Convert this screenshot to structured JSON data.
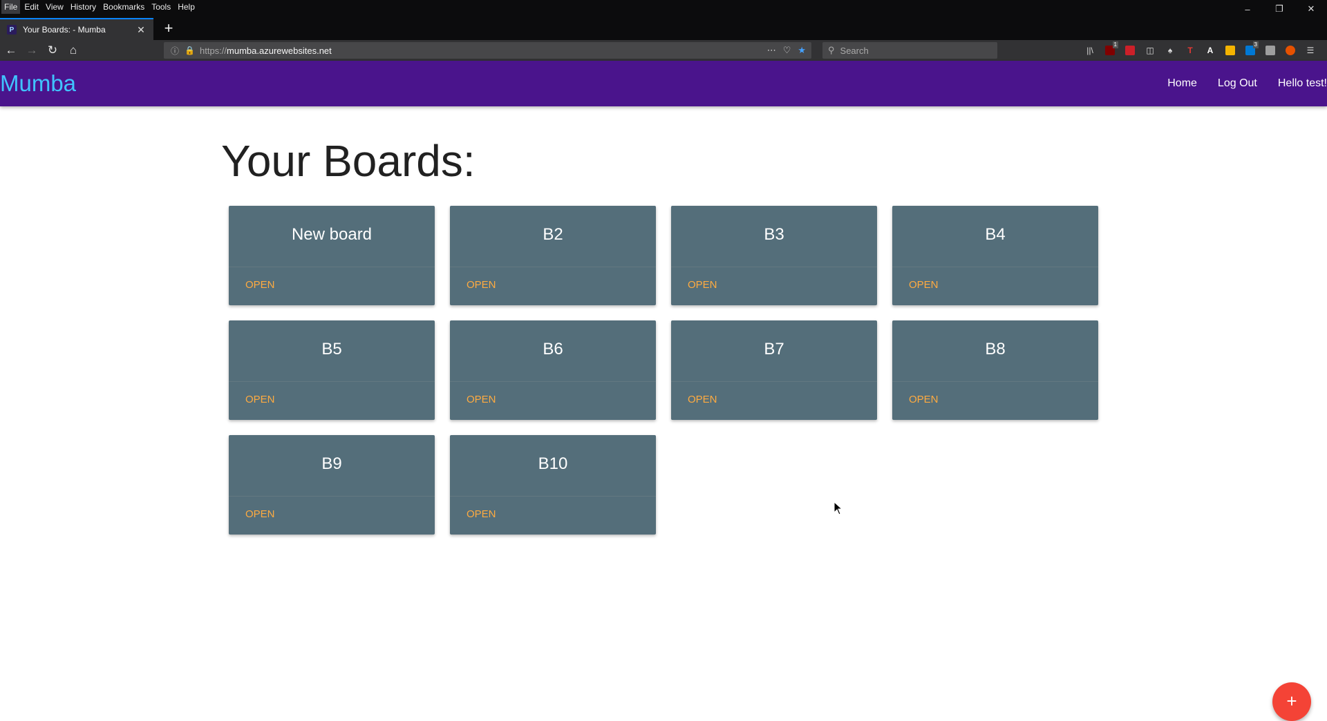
{
  "browser": {
    "menu": [
      "File",
      "Edit",
      "View",
      "History",
      "Bookmarks",
      "Tools",
      "Help"
    ],
    "tab": {
      "title": "Your Boards: - Mumba",
      "favicon_letter": "P"
    },
    "url": {
      "protocol": "https://",
      "host": "mumba.azurewebsites.net"
    },
    "search_placeholder": "Search"
  },
  "app": {
    "brand": "Mumba",
    "nav_links": [
      "Home",
      "Log Out",
      "Hello test!"
    ],
    "page_title": "Your Boards:",
    "open_label": "OPEN",
    "boards": [
      {
        "title": "New board"
      },
      {
        "title": "B2"
      },
      {
        "title": "B3"
      },
      {
        "title": "B4"
      },
      {
        "title": "B5"
      },
      {
        "title": "B6"
      },
      {
        "title": "B7"
      },
      {
        "title": "B8"
      },
      {
        "title": "B9"
      },
      {
        "title": "B10"
      }
    ],
    "fab_label": "+",
    "colors": {
      "nav_bg": "#4a148c",
      "brand": "#40c4ff",
      "card_bg": "#546e7a",
      "open_link": "#ffab40",
      "fab": "#f44336"
    }
  }
}
